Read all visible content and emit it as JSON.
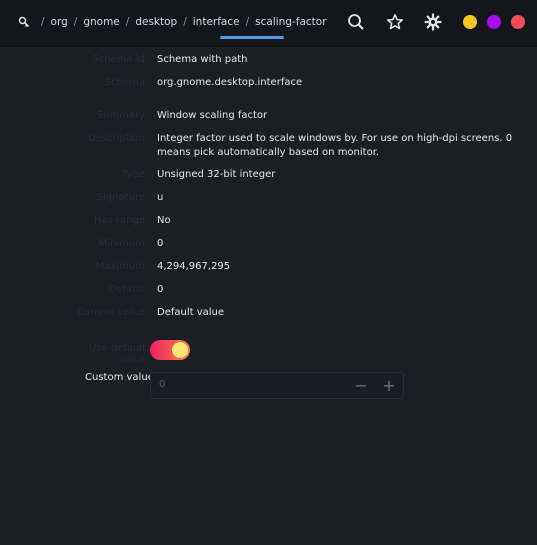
{
  "breadcrumb": {
    "segments": [
      "org",
      "gnome",
      "desktop",
      "interface",
      "scaling-factor"
    ],
    "separator": "/",
    "active_index": 4
  },
  "header_icons": [
    "search-icon",
    "star-icon",
    "gear-icon"
  ],
  "window_dots": [
    {
      "name": "minimize",
      "color": "#f2c824"
    },
    {
      "name": "maximize",
      "color": "#a80ee6"
    },
    {
      "name": "close",
      "color": "#f24d57"
    }
  ],
  "properties": [
    {
      "label": "Schema id",
      "value": "Schema with path"
    },
    {
      "label": "Schema",
      "value": "org.gnome.desktop.interface"
    },
    {
      "label": "Summary",
      "value": "Window scaling factor"
    },
    {
      "label": "Description",
      "value": "Integer factor used to scale windows by. For use on high-dpi screens. 0 means pick automatically based on monitor."
    },
    {
      "label": "Type",
      "value": "Unsigned 32-bit integer"
    },
    {
      "label": "Signature",
      "value": "u"
    },
    {
      "label": "Has range",
      "value": "No"
    },
    {
      "label": "Minimum",
      "value": "0"
    },
    {
      "label": "Maximum",
      "value": "4,294,967,295"
    },
    {
      "label": "Default",
      "value": "0"
    },
    {
      "label": "Current value",
      "value": "Default value"
    }
  ],
  "toggle": {
    "label": "Use default value",
    "on": true
  },
  "custom_value": {
    "label": "Custom value",
    "value": "0",
    "minus": "−",
    "plus": "+"
  }
}
